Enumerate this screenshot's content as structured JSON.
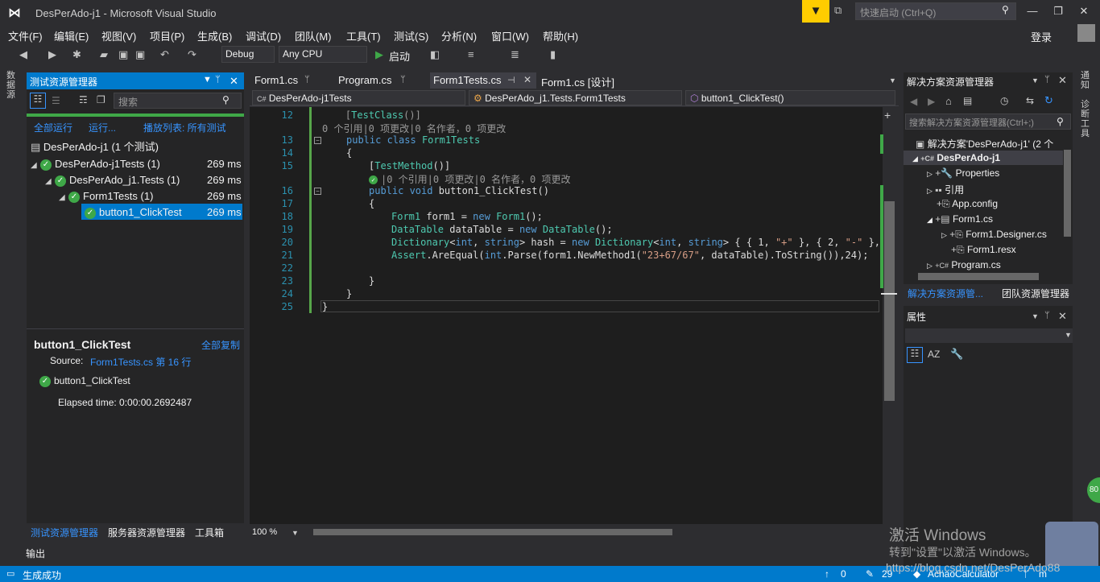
{
  "window": {
    "title": "DesPerAdo-j1 - Microsoft Visual Studio"
  },
  "quick_launch": {
    "placeholder": "快速启动 (Ctrl+Q)"
  },
  "menu": [
    "文件(F)",
    "编辑(E)",
    "视图(V)",
    "项目(P)",
    "生成(B)",
    "调试(D)",
    "团队(M)",
    "工具(T)",
    "测试(S)",
    "分析(N)",
    "窗口(W)",
    "帮助(H)"
  ],
  "login": "登录",
  "toolbar": {
    "config": "Debug",
    "platform": "Any CPU",
    "start": "启动"
  },
  "left_strip": {
    "label": "数据源"
  },
  "test_explorer": {
    "title": "测试资源管理器",
    "search_placeholder": "搜索",
    "run_all": "全部运行",
    "run": "运行...",
    "playlist": "播放列表: 所有测试",
    "tree": [
      {
        "label": "DesPerAdo-j1 (1 个测试)",
        "time": ""
      },
      {
        "label": "DesPerAdo-j1Tests (1)",
        "time": "269 ms"
      },
      {
        "label": "DesPerAdo_j1.Tests (1)",
        "time": "269 ms"
      },
      {
        "label": "Form1Tests (1)",
        "time": "269 ms"
      },
      {
        "label": "button1_ClickTest",
        "time": "269 ms"
      }
    ],
    "detail": {
      "name": "button1_ClickTest",
      "copy_all": "全部复制",
      "source_label": "Source:",
      "source_link": "Form1Tests.cs 第 16 行",
      "result": "button1_ClickTest",
      "elapsed": "Elapsed time: 0:00:00.2692487"
    },
    "bottom_tabs": [
      "测试资源管理器",
      "服务器资源管理器",
      "工具箱"
    ]
  },
  "editor": {
    "tabs": [
      "Form1.cs",
      "Program.cs",
      "Form1Tests.cs",
      "Form1.cs [设计]"
    ],
    "nav": {
      "project": "DesPerAdo-j1Tests",
      "class": "DesPerAdo_j1.Tests.Form1Tests",
      "member": "button1_ClickTest()"
    },
    "line_numbers": [
      "12",
      "13",
      "14",
      "15",
      "16",
      "17",
      "18",
      "19",
      "20",
      "21",
      "22",
      "23",
      "24",
      "25"
    ],
    "codelens1": "0 个引用|0 项更改|0 名作者，0 项更改",
    "codelens2": "|0 个引用|0 项更改|0 名作者，0 项更改",
    "zoom": "100 %"
  },
  "solution_explorer": {
    "title": "解决方案资源管理器",
    "search_placeholder": "搜索解决方案资源管理器(Ctrl+;)",
    "items": [
      {
        "label": "解决方案'DesPerAdo-j1' (2 个"
      },
      {
        "label": "DesPerAdo-j1"
      },
      {
        "label": "Properties"
      },
      {
        "label": "引用"
      },
      {
        "label": "App.config"
      },
      {
        "label": "Form1.cs"
      },
      {
        "label": "Form1.Designer.cs"
      },
      {
        "label": "Form1.resx"
      },
      {
        "label": "Program.cs"
      }
    ],
    "bottom_tabs": [
      "解决方案资源管...",
      "团队资源管理器"
    ]
  },
  "properties": {
    "title": "属性"
  },
  "right_strip": {
    "labels": [
      "通知",
      "诊断工具"
    ]
  },
  "output": {
    "label": "输出"
  },
  "status": {
    "text": "生成成功",
    "up": "0",
    "edits": "29",
    "repo": "AchaoCalculator",
    "branch": "m"
  },
  "watermark": {
    "line1": "激活 Windows",
    "line2": "转到\"设置\"以激活 Windows。",
    "url": "https://blog.csdn.net/DesPerAdo88"
  },
  "badge": "80"
}
